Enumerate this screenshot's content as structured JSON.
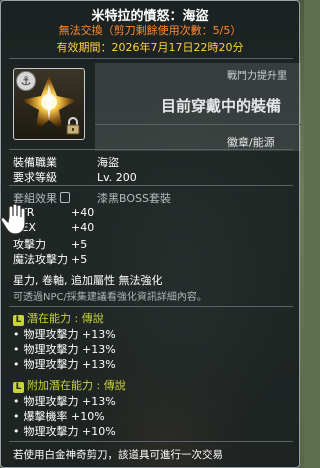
{
  "item": {
    "name": "米特拉的憤怒：海盜",
    "untradable": "無法交換（剪刀剩餘使用次數：5/5）",
    "expiry_label": "有效期間：",
    "expiry_value": "2026年7月17日22時20分"
  },
  "preview": {
    "power_text": "戰鬥力提升里",
    "title": "目前穿戴中的裝備",
    "type": "徽章/能源"
  },
  "equip_job": {
    "label": "裝備職業",
    "value": "海盜"
  },
  "req_level": {
    "label": "要求等級",
    "value": "Lv. 200"
  },
  "set": {
    "label": "套組效果",
    "value": "漆黑BOSS套裝"
  },
  "stats": [
    {
      "label": "STR",
      "value": "+40"
    },
    {
      "label": "DEX",
      "value": "+40"
    },
    {
      "label": "攻擊力",
      "value": "+5"
    },
    {
      "label": "魔法攻擊力",
      "value": "+5"
    }
  ],
  "restrictions": "星力, 卷軸, 追加屬性 無法強化",
  "npc_note": "可透過NPC/採集建議看強化資訊詳細內容。",
  "potential": {
    "badge": "L",
    "title": "潛在能力 : 傳說",
    "lines": [
      "物理攻擊力 +13%",
      "物理攻擊力 +13%",
      "物理攻擊力 +13%"
    ]
  },
  "bonus_potential": {
    "badge": "L",
    "title": "附加潛在能力 : 傳說",
    "lines": [
      "物理攻擊力 +13%",
      "爆擊機率 +10%",
      "物理攻擊力 +10%"
    ]
  },
  "footer": "若使用白金神奇剪刀，該道具可進行一次交易",
  "colors": {
    "title": "#ffffff",
    "untradable": "#ff8a32",
    "expiry": "#ffd23f",
    "legendary": "#c7d33a"
  }
}
